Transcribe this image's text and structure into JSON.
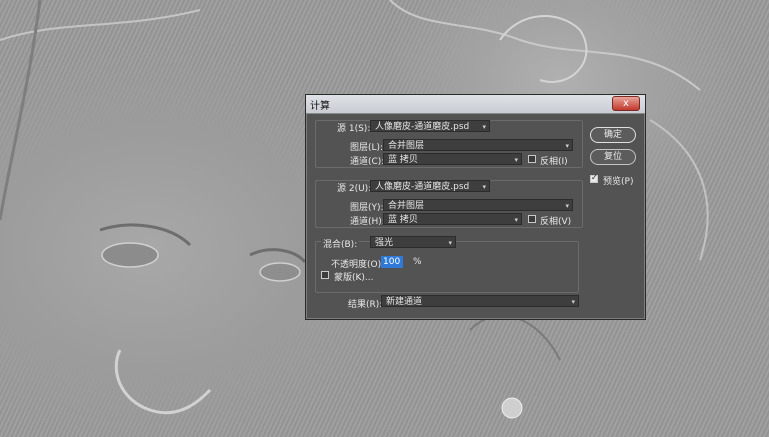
{
  "dialog": {
    "title": "计算",
    "close_label": "x"
  },
  "source1": {
    "label": "源 1(S):",
    "file": "人像磨皮-通道磨皮.psd",
    "layer_label": "图层(L):",
    "layer": "合并图层",
    "channel_label": "通道(C):",
    "channel": "蓝 拷贝",
    "invert_label": "反相(I)",
    "invert_checked": false
  },
  "source2": {
    "label": "源 2(U):",
    "file": "人像磨皮-通道磨皮.psd",
    "layer_label": "图层(Y):",
    "layer": "合并图层",
    "channel_label": "通道(H):",
    "channel": "蓝 拷贝",
    "invert_label": "反相(V)",
    "invert_checked": false
  },
  "blending": {
    "label": "混合(B):",
    "mode": "强光",
    "opacity_label": "不透明度(O):",
    "opacity": "100",
    "opacity_unit": "%",
    "mask_label": "蒙版(K)...",
    "mask_checked": false
  },
  "result": {
    "label": "结果(R):",
    "value": "新建通道"
  },
  "buttons": {
    "ok": "确定",
    "reset": "复位",
    "preview_label": "预览(P)",
    "preview_checked": true
  }
}
